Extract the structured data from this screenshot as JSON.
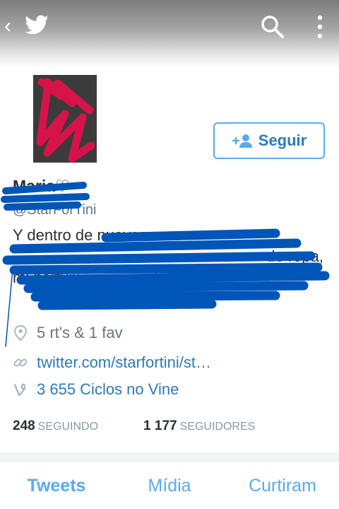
{
  "topbar": {
    "back_glyph": "‹",
    "logo_icon": "twitter-bird-icon",
    "search_icon": "search-icon",
    "more_icon": "more-vertical-icon"
  },
  "profile": {
    "name": "Maria♡",
    "handle": "@StarForTini",
    "bio_lines": [
      "Y dentro de  nuevos",
      "de ropa,",
      "mi perfume, un canal de You"
    ],
    "follow_label": "Seguir",
    "follow_icon": "add-user-icon",
    "location": "5 rt's & 1 fav",
    "url": "twitter.com/starfortini/st…",
    "vine": "3 655 Ciclos no Vine"
  },
  "stats": [
    {
      "value": "248",
      "label": "SEGUINDO"
    },
    {
      "value": "1 177",
      "label": "SEGUIDORES"
    }
  ],
  "tabs": [
    {
      "label": "Tweets",
      "active": true
    },
    {
      "label": "Mídia",
      "active": false
    },
    {
      "label": "Curtiram",
      "active": false
    }
  ],
  "colors": {
    "accent": "#55acee",
    "link": "#2b7bb9",
    "redaction": "#0055b8",
    "avatar_mark": "#d6144a"
  }
}
